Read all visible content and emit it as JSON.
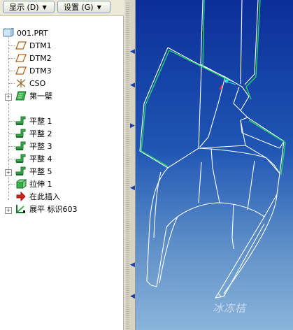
{
  "toolbar": {
    "show_label": "显示 (D)",
    "settings_label": "设置 (G)"
  },
  "tree": {
    "items": [
      {
        "label": "001.PRT",
        "icon": "part-icon"
      },
      {
        "label": "DTM1",
        "icon": "datum-plane-icon"
      },
      {
        "label": "DTM2",
        "icon": "datum-plane-icon"
      },
      {
        "label": "DTM3",
        "icon": "datum-plane-icon"
      },
      {
        "label": "CSO",
        "icon": "coordinate-system-icon"
      },
      {
        "label": "第一壁",
        "icon": "first-wall-icon"
      },
      {
        "label": "平整 1",
        "icon": "flat-wall-icon"
      },
      {
        "label": "平整 2",
        "icon": "flat-wall-icon"
      },
      {
        "label": "平整 3",
        "icon": "flat-wall-icon"
      },
      {
        "label": "平整 4",
        "icon": "flat-wall-icon"
      },
      {
        "label": "平整 5",
        "icon": "flat-wall-icon"
      },
      {
        "label": "拉伸 1",
        "icon": "extrude-icon"
      },
      {
        "label": "在此插入",
        "icon": "insert-here-arrow-icon"
      },
      {
        "label": "展平 标识603",
        "icon": "unbend-icon"
      }
    ]
  },
  "graphics": {
    "watermark": "冰冻桔",
    "background_top": "#0b2e99",
    "background_bottom": "#8ab4da",
    "edge_color_white": "#ffffff",
    "edge_color_highlight": "#22d36a"
  }
}
